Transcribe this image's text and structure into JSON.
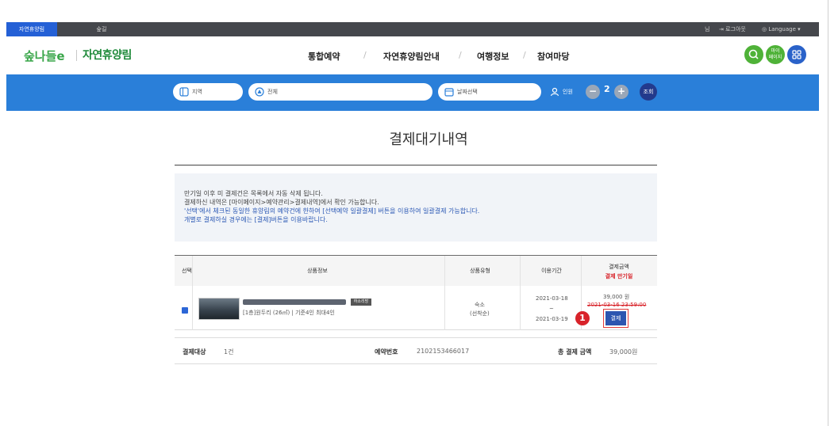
{
  "topbar": {
    "tabs": [
      "자연휴양림",
      "숲길"
    ],
    "user_suffix": "님",
    "logout": "로그아웃",
    "language": "Language"
  },
  "header": {
    "logo_mark": "숲나들e",
    "logo_text": "자연휴양림",
    "nav": [
      "통합예약",
      "자연휴양림안내",
      "여행정보",
      "참여마당"
    ],
    "separator": "/",
    "mypage_label": "마이\n페이지"
  },
  "search": {
    "region_label": "지역",
    "forest_label": "전체",
    "date_label": "날짜선택",
    "guests_label": "인원",
    "guests_count": "2",
    "minus": "−",
    "plus": "+",
    "submit_label": "조회"
  },
  "page": {
    "title": "결제대기내역"
  },
  "notice": {
    "lines": [
      "만기일 이후 미 결제건은 목록에서 자동 삭제 됩니다.",
      "결제하신 내역은 [마이페이지>예약관리>결제내역]에서 확인 가능합니다.",
      "'선택'에서 체크된 동일한 휴양림의 예약건에 한하여 [선택예약 일괄결제] 버튼을 이용하여 일괄결제 가능합니다.",
      "개별로 결제하실 경우에는 [결제]버튼을 이용바랍니다."
    ]
  },
  "table": {
    "headers": {
      "select": "선택",
      "product": "상품정보",
      "type": "상품유형",
      "period": "이용기간",
      "amount": "결제금액",
      "due": "결제 만기일"
    },
    "row": {
      "tag": "하소리방",
      "room_detail": "[1층]원두리 (26㎡) | 기준4인 최대4인",
      "type_line1": "숙소",
      "type_line2": "(선착순)",
      "start_date": "2021-03-18",
      "date_sep": "~",
      "end_date": "2021-03-19",
      "price": "39,000 원",
      "due_date": "2021-03-16 23:59:00",
      "pay_button": "결제",
      "step_badge": "1"
    }
  },
  "summary": {
    "target_label": "결제대상",
    "target_value": "1건",
    "reservation_label": "예약번호",
    "reservation_value": "2102153466017",
    "total_label": "총 결제 금액",
    "total_value": "39,000원"
  },
  "colors": {
    "accent_blue": "#2a7fd9",
    "brand_green": "#1f8a3a",
    "dark_bar": "#45474c",
    "pay_button": "#2c55b0",
    "badge_red": "#d8232a"
  }
}
